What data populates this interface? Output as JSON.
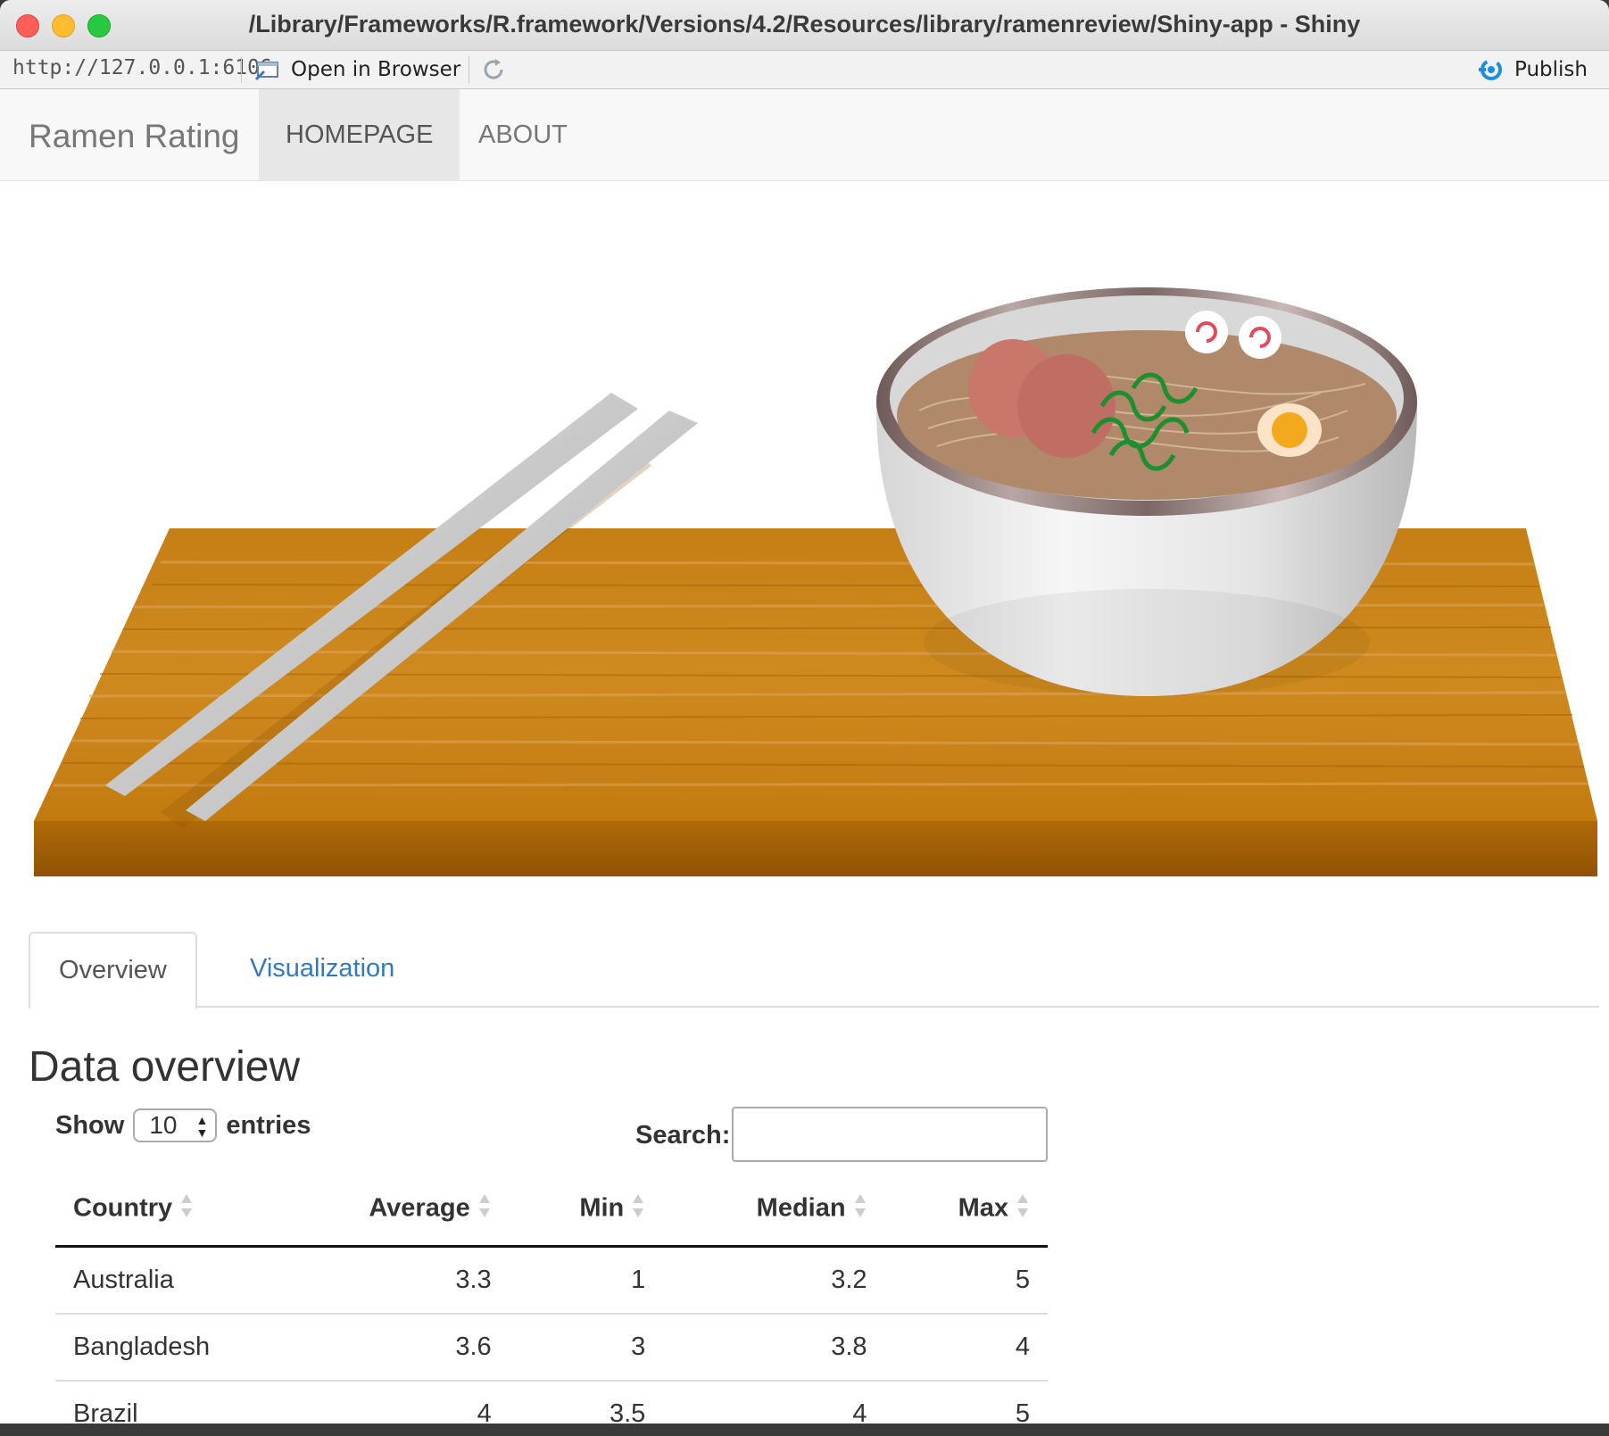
{
  "window": {
    "title": "/Library/Frameworks/R.framework/Versions/4.2/Resources/library/ramenreview/Shiny-app - Shiny"
  },
  "toolbar": {
    "url": "http://127.0.0.1:6106",
    "open_browser_label": "Open in Browser",
    "publish_label": "Publish"
  },
  "navbar": {
    "brand": "Ramen Rating",
    "items": [
      {
        "label": "HOMEPAGE",
        "active": true
      },
      {
        "label": "ABOUT",
        "active": false
      }
    ]
  },
  "tabs": [
    {
      "label": "Overview",
      "active": true
    },
    {
      "label": "Visualization",
      "active": false
    }
  ],
  "overview": {
    "heading": "Data overview",
    "show_label": "Show",
    "entries_value": "10",
    "entries_label": "entries",
    "search_label": "Search:",
    "search_value": ""
  },
  "table": {
    "columns": [
      "Country",
      "Average",
      "Min",
      "Median",
      "Max"
    ],
    "rows": [
      [
        "Australia",
        "3.3",
        "1",
        "3.2",
        "5"
      ],
      [
        "Bangladesh",
        "3.6",
        "3",
        "3.8",
        "4"
      ],
      [
        "Brazil",
        "4",
        "3.5",
        "4",
        "5"
      ]
    ]
  },
  "colors": {
    "link": "#337ab7",
    "publish_icon": "#1d8fe0",
    "wood": "#c98212"
  }
}
